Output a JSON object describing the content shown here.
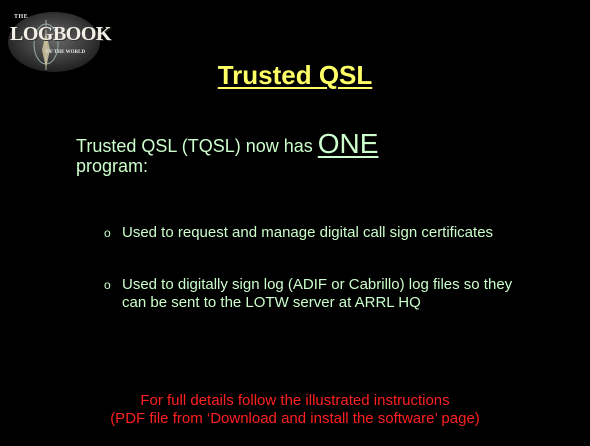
{
  "logo": {
    "top_text": "THE",
    "main_text": "LOGBOOK",
    "bottom_text": "OF THE WORLD"
  },
  "title": "Trusted QSL",
  "intro": {
    "text_before": "Trusted QSL (TQSL) now has ",
    "emphasis": "ONE",
    "text_after": "program:"
  },
  "bullets": [
    {
      "marker": "o",
      "text": "Used to request and manage digital call sign certificates"
    },
    {
      "marker": "o",
      "text": "Used to digitally sign log (ADIF or Cabrillo) log files so they can be sent to the LOTW server at ARRL HQ"
    }
  ],
  "footer": {
    "line1": "For full details follow the illustrated instructions",
    "line2": "(PDF file from ‘Download and install the software’ page)"
  },
  "colors": {
    "background": "#000000",
    "title": "#ffff66",
    "body_text": "#ccffcc",
    "footer_text": "#ff2020"
  }
}
